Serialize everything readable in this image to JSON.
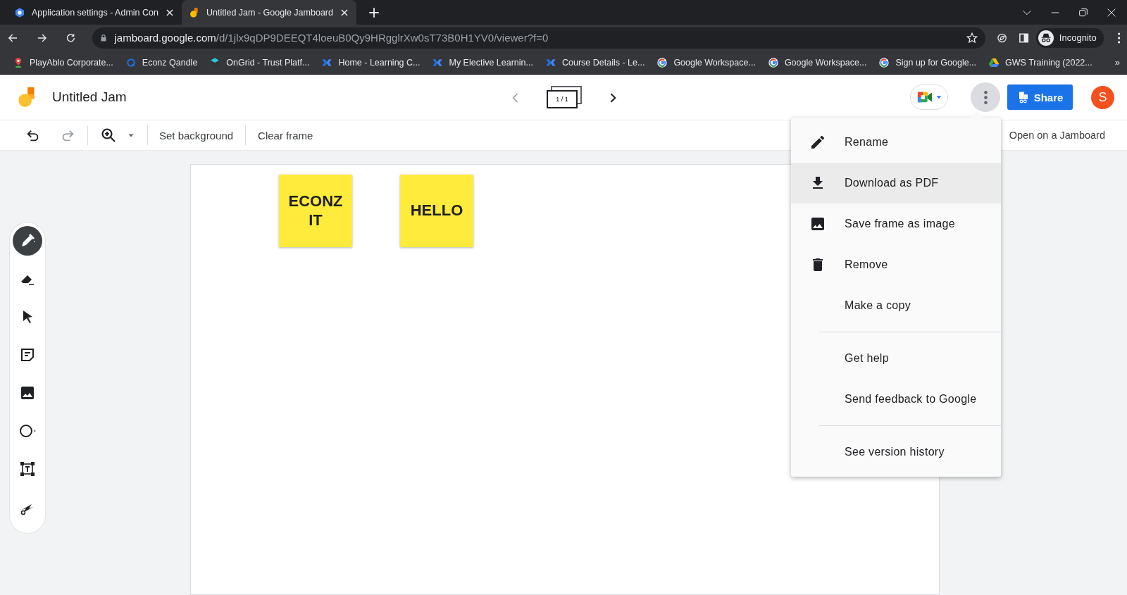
{
  "browser": {
    "tabs": [
      {
        "title": "Application settings - Admin Con",
        "kind": "admin",
        "selected": false
      },
      {
        "title": "Untitled Jam - Google Jamboard",
        "kind": "jam",
        "selected": true
      }
    ],
    "address": {
      "domain": "jamboard.google.com",
      "path": "/d/1jlx9qDP9DEEQT4loeuB0Qy9HRgglrXw0sT73B0H1YV0/viewer?f=0"
    },
    "profile": "Incognito",
    "bookmarks": [
      {
        "label": "PlayAblo Corporate...",
        "kind": "pin"
      },
      {
        "label": "Econz Qandle",
        "kind": "ring"
      },
      {
        "label": "OnGrid - Trust Platf...",
        "kind": "cube"
      },
      {
        "label": "Home - Learning C...",
        "kind": "cross"
      },
      {
        "label": "My Elective Learnin...",
        "kind": "cross"
      },
      {
        "label": "Course Details - Le...",
        "kind": "cross"
      },
      {
        "label": "Google Workspace...",
        "kind": "g"
      },
      {
        "label": "Google Workspace...",
        "kind": "g"
      },
      {
        "label": "Sign up for Google...",
        "kind": "g"
      },
      {
        "label": "GWS Training (2022...",
        "kind": "drive"
      }
    ],
    "more_bookmarks": "»"
  },
  "app": {
    "title": "Untitled Jam",
    "frame_counter": "1 / 1",
    "share": "Share",
    "avatar": "S"
  },
  "toolbar": {
    "set_background": "Set background",
    "clear_frame": "Clear frame",
    "open_on_jamboard": "Open on a Jamboard"
  },
  "tools": [
    {
      "kind": "pen",
      "selected": true
    },
    {
      "kind": "eraser",
      "selected": false
    },
    {
      "kind": "select",
      "selected": false
    },
    {
      "kind": "note",
      "selected": false
    },
    {
      "kind": "image",
      "selected": false
    },
    {
      "kind": "shape",
      "selected": false
    },
    {
      "kind": "textbox",
      "selected": false
    },
    {
      "kind": "laser",
      "selected": false
    }
  ],
  "notes": [
    {
      "text": "ECONZ IT"
    },
    {
      "text": "HELLO"
    }
  ],
  "menu": {
    "groups": [
      [
        {
          "label": "Rename",
          "kind": "pencil",
          "selected": false
        },
        {
          "label": "Download as PDF",
          "kind": "download",
          "selected": true
        },
        {
          "label": "Save frame as image",
          "kind": "image",
          "selected": false
        },
        {
          "label": "Remove",
          "kind": "trash",
          "selected": false
        },
        {
          "label": "Make a copy",
          "kind": "none",
          "selected": false
        }
      ],
      [
        {
          "label": "Get help",
          "kind": "none",
          "selected": false
        },
        {
          "label": "Send feedback to Google",
          "kind": "none",
          "selected": false
        }
      ],
      [
        {
          "label": "See version history",
          "kind": "none",
          "selected": false
        }
      ]
    ]
  }
}
